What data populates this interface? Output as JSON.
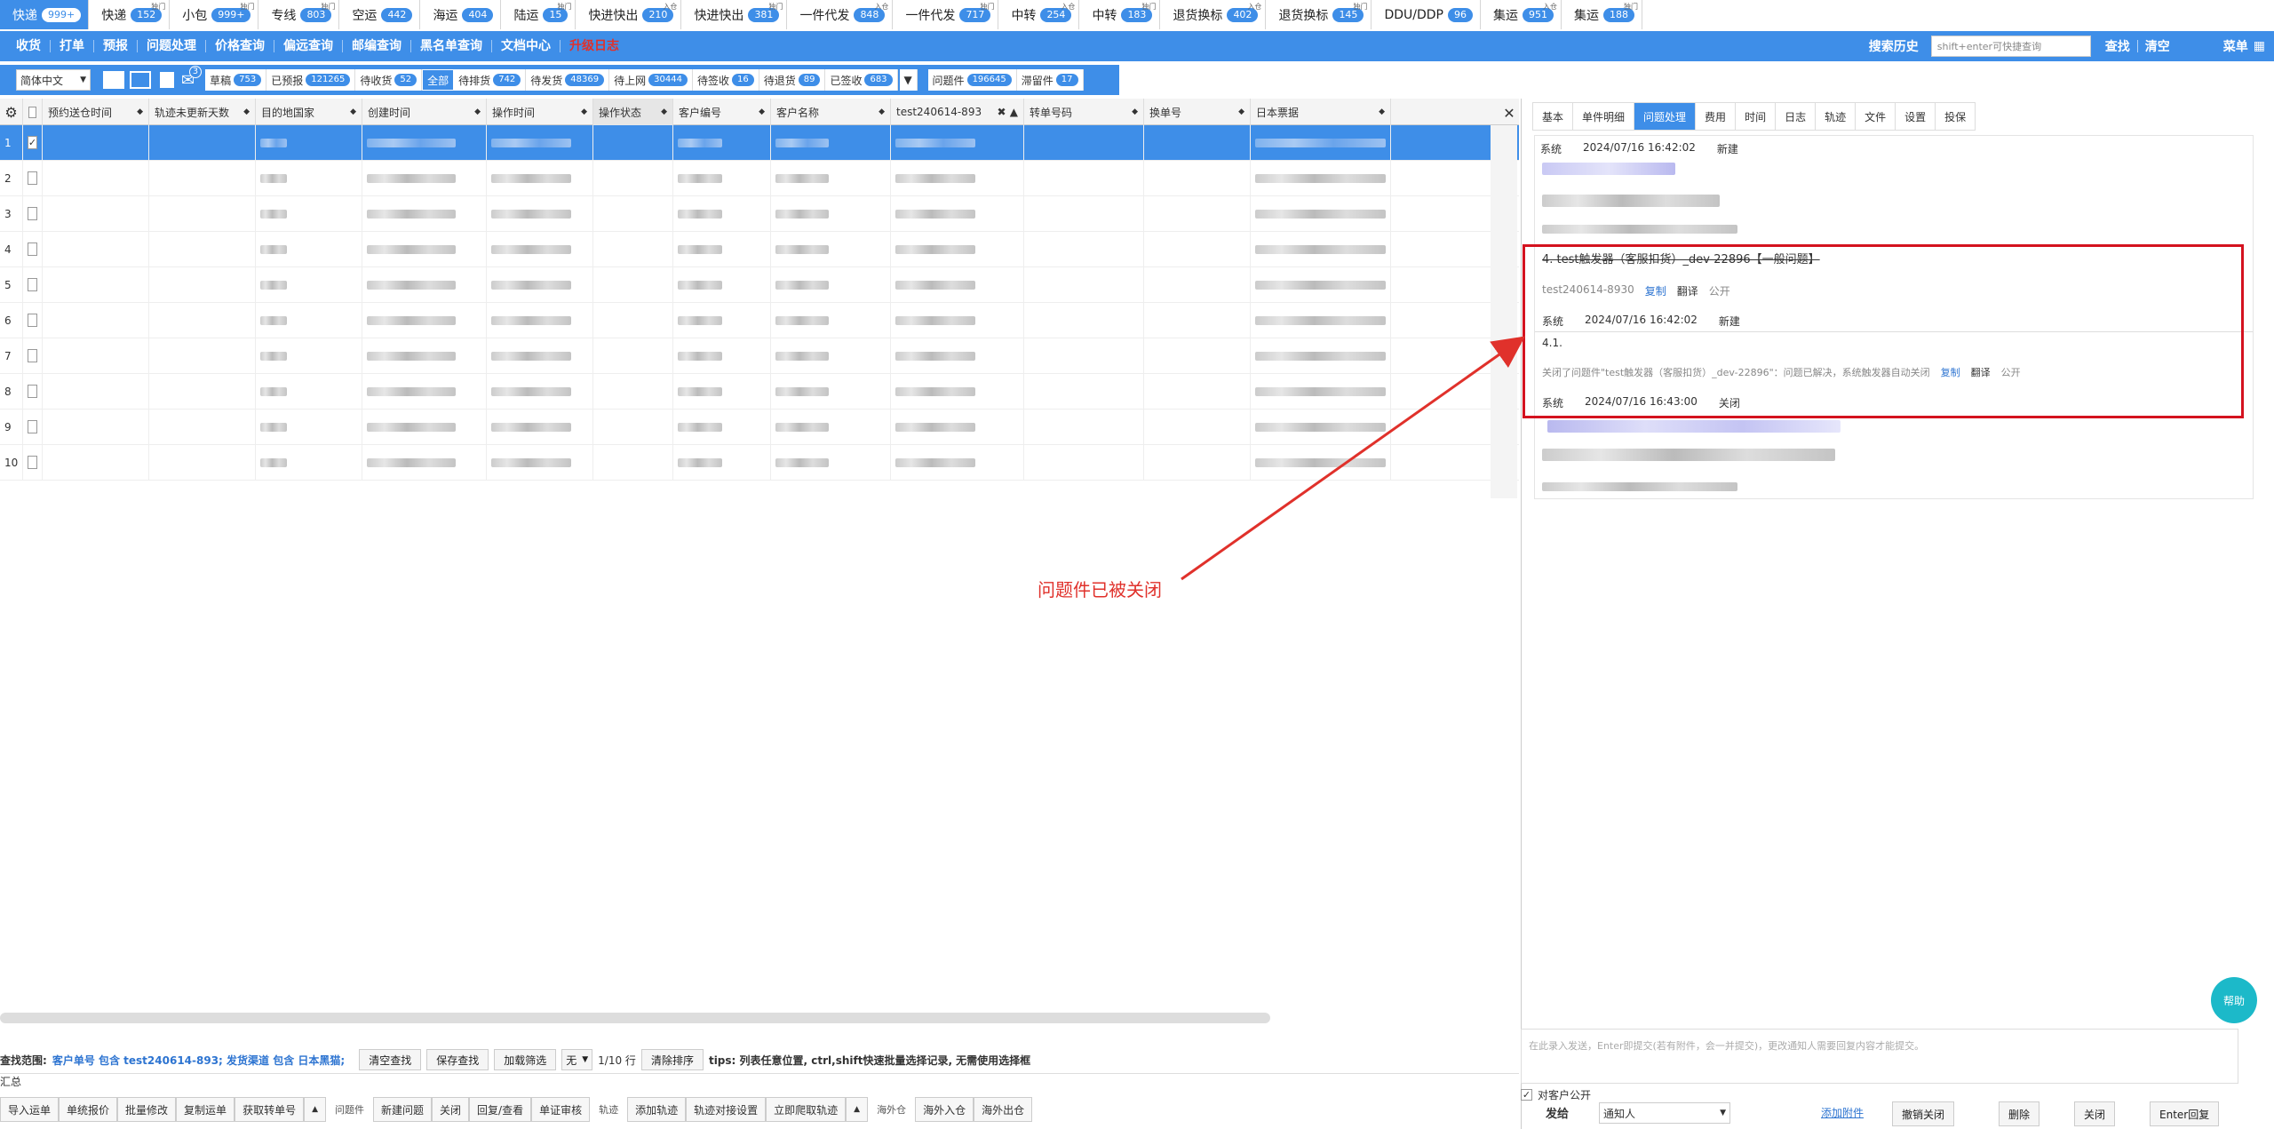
{
  "top_tabs": [
    {
      "label": "快递",
      "count": "999+",
      "sup": "",
      "active": true
    },
    {
      "label": "快递",
      "count": "152",
      "sup": "独门"
    },
    {
      "label": "小包",
      "count": "999+",
      "sup": "独门"
    },
    {
      "label": "专线",
      "count": "803",
      "sup": "独门"
    },
    {
      "label": "空运",
      "count": "442",
      "sup": ""
    },
    {
      "label": "海运",
      "count": "404",
      "sup": ""
    },
    {
      "label": "陆运",
      "count": "15",
      "sup": "独门"
    },
    {
      "label": "快进快出",
      "count": "210",
      "sup": "入仓"
    },
    {
      "label": "快进快出",
      "count": "381",
      "sup": "独门"
    },
    {
      "label": "一件代发",
      "count": "848",
      "sup": "入仓"
    },
    {
      "label": "一件代发",
      "count": "717",
      "sup": "独门"
    },
    {
      "label": "中转",
      "count": "254",
      "sup": "入仓"
    },
    {
      "label": "中转",
      "count": "183",
      "sup": "独门"
    },
    {
      "label": "退货换标",
      "count": "402",
      "sup": "入仓"
    },
    {
      "label": "退货换标",
      "count": "145",
      "sup": "独门"
    },
    {
      "label": "DDU/DDP",
      "count": "96",
      "sup": ""
    },
    {
      "label": "集运",
      "count": "951",
      "sup": "入仓"
    },
    {
      "label": "集运",
      "count": "188",
      "sup": "独门"
    }
  ],
  "menu": [
    "收货",
    "打单",
    "预报",
    "问题处理",
    "价格查询",
    "偏远查询",
    "邮编查询",
    "黑名单查询",
    "文档中心",
    "升级日志"
  ],
  "menu_right": {
    "history": "搜索历史",
    "search_placeholder": "shift+enter可快捷查询",
    "query": "查找",
    "clear": "清空",
    "menu": "菜单"
  },
  "filter": {
    "lang": "简体中文",
    "mail_badge": "3",
    "pills": [
      {
        "label": "草稿",
        "count": "753"
      },
      {
        "label": "已预报",
        "count": "121265"
      },
      {
        "label": "待收货",
        "count": "52"
      },
      {
        "label": "全部",
        "count": "",
        "active": true
      },
      {
        "label": "待排货",
        "count": "742"
      },
      {
        "label": "待发货",
        "count": "48369"
      },
      {
        "label": "待上网",
        "count": "30444"
      },
      {
        "label": "待签收",
        "count": "16"
      },
      {
        "label": "待退货",
        "count": "89"
      },
      {
        "label": "已签收",
        "count": "683"
      }
    ],
    "extra": [
      {
        "label": "问题件",
        "count": "196645"
      },
      {
        "label": "滞留件",
        "count": "17"
      }
    ]
  },
  "grid": {
    "headers": [
      "预约送仓时间",
      "轨迹未更新天数",
      "目的地国家",
      "创建时间",
      "操作时间",
      "操作状态",
      "客户编号",
      "客户名称",
      "test240614-893",
      "转单号码",
      "换单号",
      "日本票据"
    ],
    "rows": [
      "1",
      "2",
      "3",
      "4",
      "5",
      "6",
      "7",
      "8",
      "9",
      "10"
    ]
  },
  "query": {
    "label": "查找范围:",
    "expr": "客户单号 包含 test240614-893; 发货渠道 包含 日本黑猫;",
    "clear": "清空查找",
    "save": "保存查找",
    "load": "加载筛选",
    "none": "无",
    "page": "1/10 行",
    "clear_sort": "清除排序",
    "tips": "tips: 列表任意位置, ctrl,shift快速批量选择记录, 无需使用选择框"
  },
  "summary": "汇总",
  "actions": {
    "g1": [
      "导入运单",
      "单统报价",
      "批量修改",
      "复制运单",
      "获取转单号"
    ],
    "g2_label": "问题件",
    "g2": [
      "新建问题",
      "关闭",
      "回复/查看",
      "单证审核"
    ],
    "g3_label": "轨迹",
    "g3": [
      "添加轨迹",
      "轨迹对接设置",
      "立即爬取轨迹"
    ],
    "g4_label": "海外仓",
    "g4": [
      "海外入仓",
      "海外出仓"
    ]
  },
  "rtabs": [
    "基本",
    "单件明细",
    "问题处理",
    "费用",
    "时间",
    "日志",
    "轨迹",
    "文件",
    "设置",
    "投保"
  ],
  "issues": {
    "top_meta": {
      "who": "系统",
      "time": "2024/07/16 16:42:02",
      "status": "新建"
    },
    "issue4": {
      "title": "4. test触发器（客服扣货）_dev-22896【一般问题】",
      "ref": "test240614-8930",
      "copy": "复制",
      "translate": "翻译",
      "public": "公开",
      "who": "系统",
      "time": "2024/07/16 16:42:02",
      "status": "新建"
    },
    "issue41": {
      "title": "4.1.",
      "text": "关闭了问题件\"test触发器（客服扣货）_dev-22896\"：问题已解决，系统触发器自动关闭",
      "copy": "复制",
      "translate": "翻译",
      "public": "公开",
      "who": "系统",
      "time": "2024/07/16 16:43:00",
      "status": "关闭"
    }
  },
  "annotation": "问题件已被关闭",
  "reply": {
    "placeholder": "在此录入发送，Enter即提交(若有附件，会一并提交)，更改通知人需要回复内容才能提交。",
    "public_label": "对客户公开",
    "send_to": "发给",
    "notify": "通知人",
    "attach": "添加附件",
    "revoke": "撤销关闭",
    "delete": "删除",
    "close": "关闭",
    "enter": "Enter回复"
  },
  "help": "帮助",
  "colors": {
    "primary": "#3e8ee8",
    "annotation": "#e0312b",
    "help": "#1cb9c9"
  }
}
